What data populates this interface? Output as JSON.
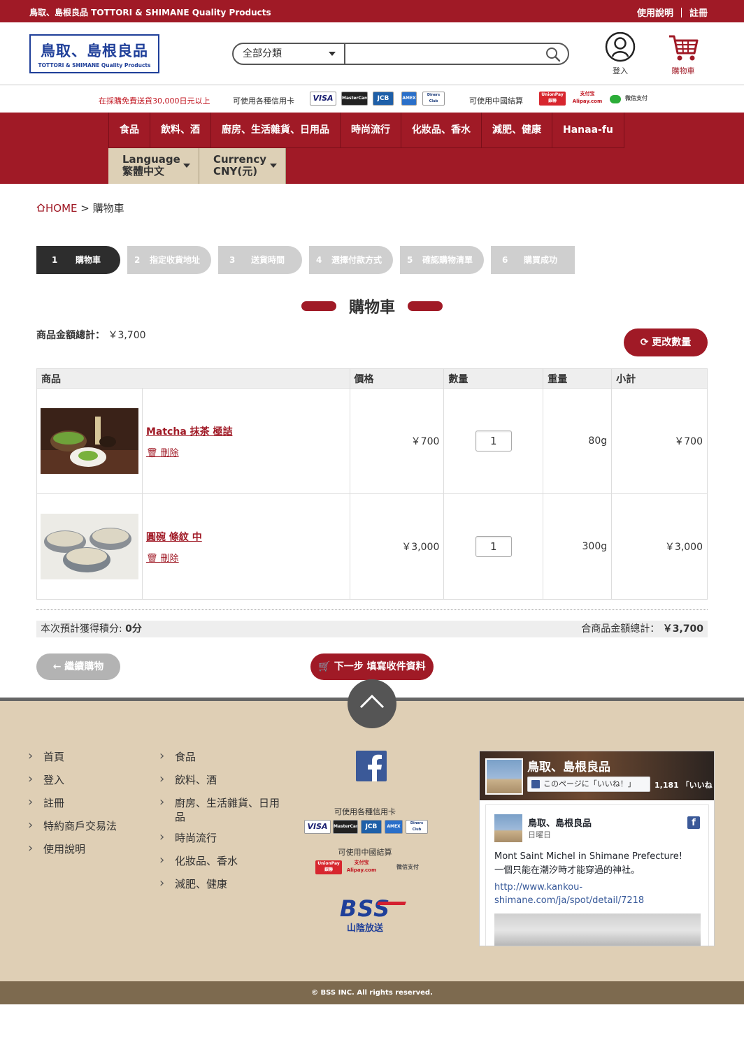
{
  "topbar": {
    "tagline": "鳥取、島根良品 TOTTORI & SHIMANE Quality Products",
    "guide_label": "使用說明",
    "register_label": "註冊"
  },
  "header": {
    "logo_jp": "鳥取、島根良品",
    "logo_en": "TOTTORI & SHIMANE Quality Products",
    "search": {
      "category": "全部分類",
      "placeholder": ""
    },
    "login_label": "登入",
    "cart_label": "購物車"
  },
  "paybar": {
    "free_shipping": "在採購免費送貨30,000日元以上",
    "credit_label": "可使用各種信用卡",
    "china_label": "可使用中國結算",
    "cards": [
      "VISA",
      "MasterCard",
      "JCB",
      "AMEX",
      "Diners Club"
    ],
    "china_methods": [
      "UnionPay 銀聯",
      "支付宝 Alipay.com",
      "微信支付"
    ]
  },
  "nav": {
    "items": [
      "食品",
      "飲料、酒",
      "廚房、生活雜貨、日用品",
      "時尚流行",
      "化妝品、香水",
      "減肥、健康",
      "Hanaa-fu"
    ],
    "language_label": "Language",
    "language_value": "繁體中文",
    "currency_label": "Currency",
    "currency_value": "CNY(元)"
  },
  "breadcrumb": {
    "home": "HOME",
    "sep": ">",
    "current": "購物車"
  },
  "steps": [
    {
      "n": "1",
      "label": "購物車"
    },
    {
      "n": "2",
      "label": "指定收貨地址"
    },
    {
      "n": "3",
      "label": "送貨時間"
    },
    {
      "n": "4",
      "label": "選擇付款方式"
    },
    {
      "n": "5",
      "label": "確認購物清單"
    },
    {
      "n": "6",
      "label": "購買成功"
    }
  ],
  "cart": {
    "title": "購物車",
    "total_label": "商品金額總計：",
    "total_value": "￥3,700",
    "update_button": "更改數量",
    "columns": [
      "商品",
      "價格",
      "數量",
      "重量",
      "小計"
    ],
    "rows": [
      {
        "name": "Matcha 抹茶 極詰",
        "delete": "刪除",
        "price": "￥700",
        "qty": "1",
        "weight": "80g",
        "subtotal": "￥700"
      },
      {
        "name": "圓碗 條紋 中",
        "delete": "刪除",
        "price": "￥3,000",
        "qty": "1",
        "weight": "300g",
        "subtotal": "￥3,000"
      }
    ],
    "points_label": "本次預計獲得積分:",
    "points_value": "0分",
    "grand_label": "合商品金額總計：",
    "grand_value": "￥3,700",
    "back_button": "繼續購物",
    "next_button": "下一步 填寫收件資料"
  },
  "footer": {
    "col1": [
      "首頁",
      "登入",
      "註冊",
      "特約商戶交易法",
      "使用說明"
    ],
    "col2": [
      "食品",
      "飲料、酒",
      "廚房、生活雜貨、日用品",
      "時尚流行",
      "化妝品、香水",
      "減肥、健康"
    ],
    "credit_label": "可使用各種信用卡",
    "china_label": "可使用中國結算",
    "bss_logo": "BSS",
    "bss_sub": "山陰放送",
    "copyright": "© BSS INC. All rights reserved."
  },
  "facebook": {
    "page_name": "鳥取、島根良品",
    "like_button": "このページに「いいね！」",
    "like_count": "1,181",
    "like_suffix": "「いいね",
    "post_author": "鳥取、島根良品",
    "post_date": "日曜日",
    "post_body_1": "Mont Saint Michel in Shimane Prefecture!",
    "post_body_2": "一個只能在潮汐時才能穿過的神社。",
    "post_link": "http://www.kankou-shimane.com/ja/spot/detail/7218"
  },
  "colors": {
    "brand_red": "#a01a26",
    "logo_blue": "#1f3f99",
    "footer_beige": "#dfcfb5",
    "copyright_brown": "#7d6a4f"
  }
}
